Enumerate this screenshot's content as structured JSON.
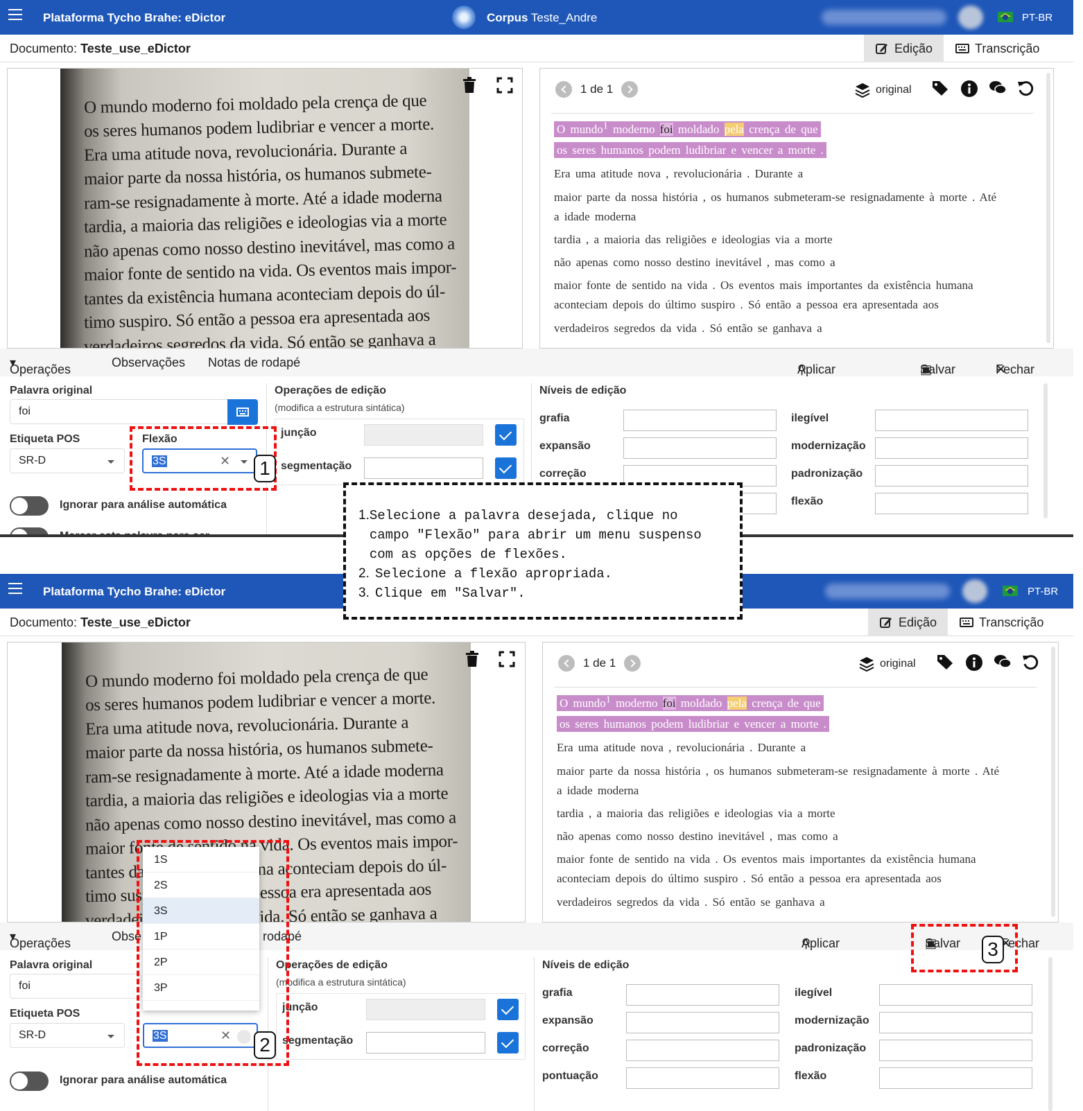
{
  "app": {
    "title": "Plataforma Tycho Brahe: eDictor",
    "corpus_label": "Corpus",
    "corpus_name": "Teste_Andre",
    "lang": "PT-BR"
  },
  "doc": {
    "label": "Documento:",
    "name": "Teste_use_eDictor",
    "tab_edit": "Edição",
    "tab_transcription": "Transcrição"
  },
  "image_lines": [
    "O mundo moderno foi moldado pela crença de que",
    "os seres humanos podem ludibriar e vencer a morte.",
    "Era uma atitude nova, revolucionária. Durante a",
    "maior parte da nossa história, os humanos submete-",
    "ram-se resignadamente à morte. Até a idade moderna",
    "tardia, a maioria das religiões e ideologias via a morte",
    "não apenas como nosso destino inevitável, mas como a",
    "maior fonte de sentido na vida. Os eventos mais impor-",
    "tantes da existência humana aconteciam depois do úl-",
    "timo suspiro. Só então a pessoa era apresentada aos",
    "verdadeiros segredos da vida. Só então se ganhava a"
  ],
  "text_pane": {
    "pager": "1 de 1",
    "view": "original",
    "l1": {
      "w1": "O mundo",
      "sup": "1",
      "w2": "moderno",
      "w3": "foi",
      "w4": "moldado",
      "w5": "pela",
      "w6": "crença de que"
    },
    "l2": "os seres humanos podem ludibriar e vencer a morte .",
    "l3": "Era uma atitude nova , revolucionária . Durante a",
    "l4": "maior parte da nossa história , os humanos submeteram-se resignadamente à morte . Até",
    "l5": "a idade moderna",
    "l6": "tardia , a maioria das religiões e ideologias via a morte",
    "l7": "não apenas como nosso destino inevitável , mas como a",
    "l8": "maior fonte de sentido na vida . Os eventos mais importantes da existência humana",
    "l9": "aconteciam depois do último suspiro . Só então a pessoa era apresentada aos",
    "l10": "verdadeiros segredos da vida . Só então se ganhava a"
  },
  "ops": {
    "operations": "Operações",
    "observations": "Observações",
    "footnotes": "Notas de rodapé",
    "footnotes_short": "rodapé",
    "observations_short": "Obse",
    "apply_all": "Aplicar a todos",
    "save": "Salvar",
    "close": "Fechar"
  },
  "form": {
    "orig_word_label": "Palavra original",
    "orig_word": "foi",
    "pos_label": "Etiqueta POS",
    "pos": "SR-D",
    "flex_label": "Flexão",
    "flex": "3S",
    "ignore_label": "Ignorar para análise automática",
    "mark_label": "Marcar esta palavra para ser",
    "edit_ops_title": "Operações de edição",
    "edit_ops_sub": "(modifica a estrutura sintática)",
    "juncao": "junção",
    "segmentacao": "segmentação",
    "levels_title": "Níveis de edição",
    "grafia": "grafia",
    "expansao": "expansão",
    "correcao": "correção",
    "pontuacao": "pontuação",
    "ilegivel": "ilegível",
    "modernizacao": "modernização",
    "padronizacao": "padronização",
    "flexao": "flexão"
  },
  "flex_options": [
    "1S",
    "2S",
    "3S",
    "1P",
    "2P",
    "3P"
  ],
  "callouts": {
    "n1": "1",
    "n2": "2",
    "n3": "3"
  },
  "note": {
    "i1": "1.",
    "t1": "Selecione a palavra desejada, clique no campo \"Flexão\" para abrir um menu suspenso com as opções de flexões.",
    "i2": "2.",
    "t2": "Selecione a flexão apropriada.",
    "i3": "3.",
    "t3": "Clique em \"Salvar\"."
  },
  "colors": {
    "brand": "#1f57b8",
    "accent": "#1a73d9",
    "highlight": "#c98ccb",
    "callout": "#e11111"
  }
}
